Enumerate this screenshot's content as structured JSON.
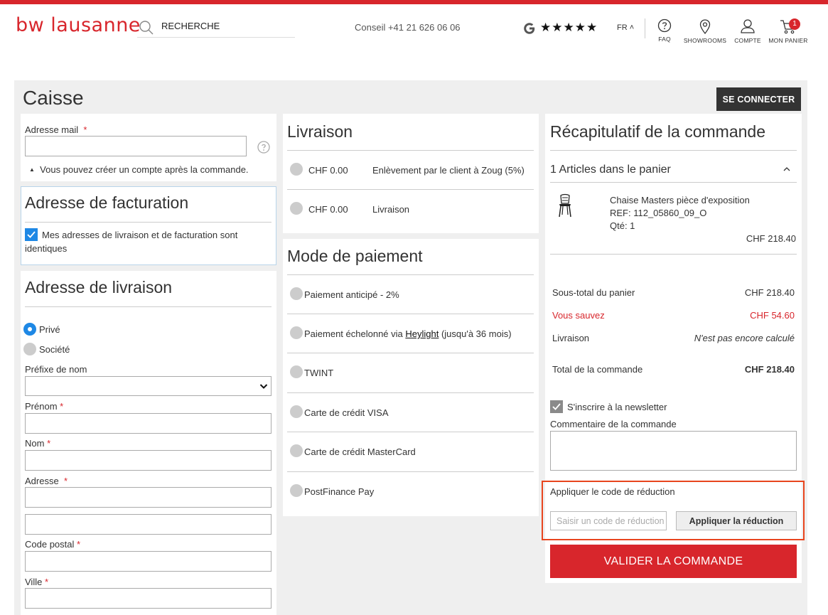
{
  "header": {
    "logo": "bw lausanne",
    "search_placeholder": "RECHERCHE",
    "phone": "Conseil +41 21 626 06 06",
    "rating_stars": "★★★★★",
    "language": "FR ˄",
    "nav": [
      {
        "label": "FAQ",
        "icon": "question-circle-icon"
      },
      {
        "label": "SHOWROOMS",
        "icon": "map-pin-icon"
      },
      {
        "label": "COMPTE",
        "icon": "user-icon"
      },
      {
        "label": "MON PANIER",
        "icon": "cart-icon"
      }
    ],
    "cart_count": "1"
  },
  "page": {
    "title": "Caisse",
    "login_button": "SE CONNECTER"
  },
  "email": {
    "label": "Adresse mail",
    "required_mark": "*",
    "note": "Vous pouvez créer un compte après la commande."
  },
  "billing": {
    "title": "Adresse de facturation",
    "same_address_label": "Mes adresses de livraison et de facturation sont identiques",
    "same_address_checked": true
  },
  "shipping_address": {
    "title": "Adresse de livraison",
    "type_options": [
      "Privé",
      "Société"
    ],
    "type_selected": "Privé",
    "prefix_label": "Préfixe de nom",
    "firstname_label": "Prénom",
    "lastname_label": "Nom",
    "address_label": "Adresse",
    "postcode_label": "Code postal",
    "city_label": "Ville"
  },
  "delivery": {
    "title": "Livraison",
    "options": [
      {
        "price": "CHF 0.00",
        "label": "Enlèvement par le client à Zoug (5%)"
      },
      {
        "price": "CHF 0.00",
        "label": "Livraison"
      }
    ]
  },
  "payment": {
    "title": "Mode de paiement",
    "options": [
      "Paiement anticipé - 2%",
      "TWINT",
      "Carte de crédit VISA",
      "Carte de crédit MasterCard",
      "PostFinance Pay"
    ],
    "heylight": {
      "prefix": "Paiement échelonné via ",
      "link": "Heylight",
      "suffix": " (jusqu'à 36 mois)"
    }
  },
  "summary": {
    "title": "Récapitulatif de la commande",
    "items_count": "1 Articles dans le panier",
    "product": {
      "name": "Chaise Masters pièce d'exposition",
      "ref": "REF: 112_05860_09_O",
      "qty": "Qté: 1",
      "price": "CHF 218.40",
      "image_icon": "chair-icon"
    },
    "subtotal_label": "Sous-total du panier",
    "subtotal_value": "CHF 218.40",
    "savings_label": "Vous sauvez",
    "savings_value": "CHF 54.60",
    "shipping_label": "Livraison",
    "shipping_value": "N'est pas encore calculé",
    "total_label": "Total de la commande",
    "total_value": "CHF 218.40",
    "newsletter_label": "S'inscrire à la newsletter",
    "comment_label": "Commentaire de la commande",
    "discount_title": "Appliquer le code de réduction",
    "discount_placeholder": "Saisir un code de réduction",
    "discount_button": "Appliquer la réduction",
    "validate_button": "VALIDER LA COMMANDE"
  },
  "colors": {
    "brand": "#d8262c",
    "accent": "#1e88e5",
    "highlight": "#e8451e"
  }
}
